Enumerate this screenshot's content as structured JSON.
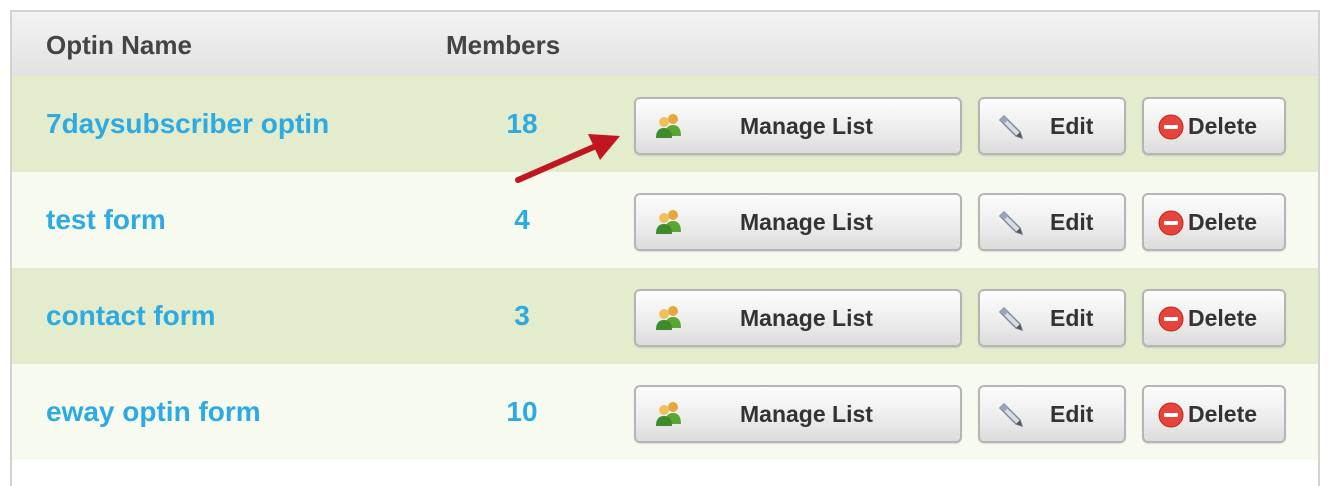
{
  "table": {
    "headers": {
      "name": "Optin Name",
      "members": "Members"
    },
    "rows": [
      {
        "name": "7daysubscriber optin",
        "members": "18"
      },
      {
        "name": "test form",
        "members": "4"
      },
      {
        "name": "contact form",
        "members": "3"
      },
      {
        "name": "eway optin form",
        "members": "10"
      }
    ]
  },
  "buttons": {
    "manage_label": "Manage List",
    "manage_icon": "users-icon",
    "edit_label": "Edit",
    "edit_icon": "pencil-icon",
    "delete_label": "Delete",
    "delete_icon": "delete-icon"
  },
  "colors": {
    "link": "#2eaae3",
    "row_odd": "#e3eccd",
    "row_even": "#f7faee",
    "header_bg": "#e8e8e8",
    "delete_icon": "#e8443a",
    "annotation_arrow": "#c0161f"
  },
  "annotation": {
    "type": "arrow",
    "points_to": "Manage List"
  }
}
